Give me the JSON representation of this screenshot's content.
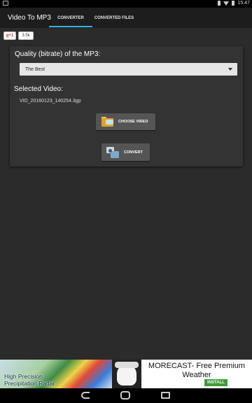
{
  "status_bar": {
    "time": "15:47"
  },
  "action_bar": {
    "title": "Video To MP3",
    "tabs": [
      {
        "label": "CONVERTER",
        "selected": true
      },
      {
        "label": "CONVERTED FILES",
        "selected": false
      }
    ]
  },
  "gplus": {
    "label": "g+1",
    "count": "3.5k"
  },
  "converter": {
    "quality_label": "Quality (bitrate) of the MP3:",
    "quality_selected": "The Best",
    "selected_video_label": "Selected Video:",
    "video_filename": "VID_20160123_140254.3gp",
    "choose_button": "CHOOSE VIDEO",
    "convert_button": "CONVERT"
  },
  "ad": {
    "radar_text_line1": "High Precision",
    "radar_text_line2": "Precipitation Radar",
    "title": "MORECAST- Free Premium Weather",
    "install": "INSTALL"
  },
  "colors": {
    "accent": "#33b5e5",
    "background": "#2b2b2b",
    "card": "#333333",
    "install": "#3f9a3a"
  }
}
